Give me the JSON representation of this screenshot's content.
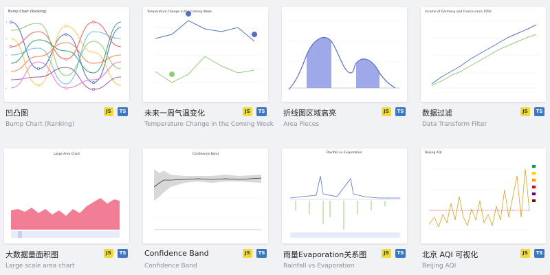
{
  "cards": [
    {
      "title_cn": "凹凸图",
      "title_en": "Bump Chart (Ranking)",
      "thumb_title": "Bump Chart (Ranking)",
      "badges": {
        "js": "JS",
        "ts": "TS"
      }
    },
    {
      "title_cn": "未来一周气温变化",
      "title_en": "Temperature Change in the Coming Week",
      "thumb_title": "Temperature Change in the Coming Week",
      "badges": {
        "js": "JS",
        "ts": "TS"
      }
    },
    {
      "title_cn": "折线图区域高亮",
      "title_en": "Area Pieces",
      "badges": {
        "js": "JS",
        "ts": "TS"
      }
    },
    {
      "title_cn": "数据过滤",
      "title_en": "Data Transform Filter",
      "thumb_title": "Income of Germany and France since 1950",
      "badges": {
        "js": "JS",
        "ts": "TS"
      }
    },
    {
      "title_cn": "大数据量面积图",
      "title_en": "Large scale area chart",
      "thumb_title": "Large Area Chart",
      "badges": {
        "js": "JS",
        "ts": "TS"
      }
    },
    {
      "title_cn": "Confidence Band",
      "title_en": "Confidence Band",
      "thumb_title": "Confidence Band",
      "badges": {
        "js": "JS",
        "ts": "TS"
      }
    },
    {
      "title_cn": "雨量Evaporation关系图",
      "title_en": "Rainfall vs Evaporation",
      "thumb_title": "Rainfall vs Evaporation",
      "badges": {
        "js": "JS",
        "ts": "TS"
      }
    },
    {
      "title_cn": "北京 AQI 可视化",
      "title_en": "Beijing AQI",
      "thumb_title": "Beijing AQI",
      "badges": {
        "js": "JS",
        "ts": "TS"
      }
    }
  ],
  "colors": {
    "js_badge": "#f0d93c",
    "ts_badge": "#3b78c3",
    "echarts_blue": "#5470c6",
    "echarts_green": "#91cc75",
    "area_fill": "#9fa8e8",
    "large_area": "#f0708a"
  }
}
